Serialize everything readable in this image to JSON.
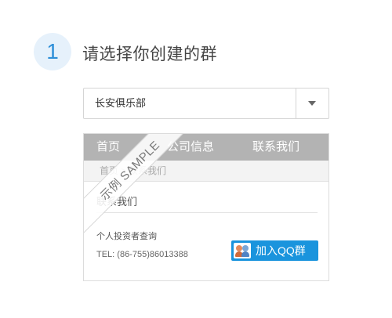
{
  "step": {
    "number": "1",
    "title": "请选择你创建的群"
  },
  "group_select": {
    "selected_value": "长安俱乐部"
  },
  "preview": {
    "nav": [
      "首页",
      "公司信息",
      "联系我们"
    ],
    "breadcrumb": {
      "home": "首页",
      "separator": ">",
      "current": "联系我们"
    },
    "section_heading": "联系我们",
    "info_label": "个人投资者查询",
    "phone": "TEL: (86-755)86013388",
    "qq_button_label": "加入QQ群",
    "watermark": "示例 SAMPLE"
  },
  "colors": {
    "accent": "#1a94dd",
    "badge_bg": "#e6f1fb",
    "nav_bg": "#b3b3b3"
  }
}
